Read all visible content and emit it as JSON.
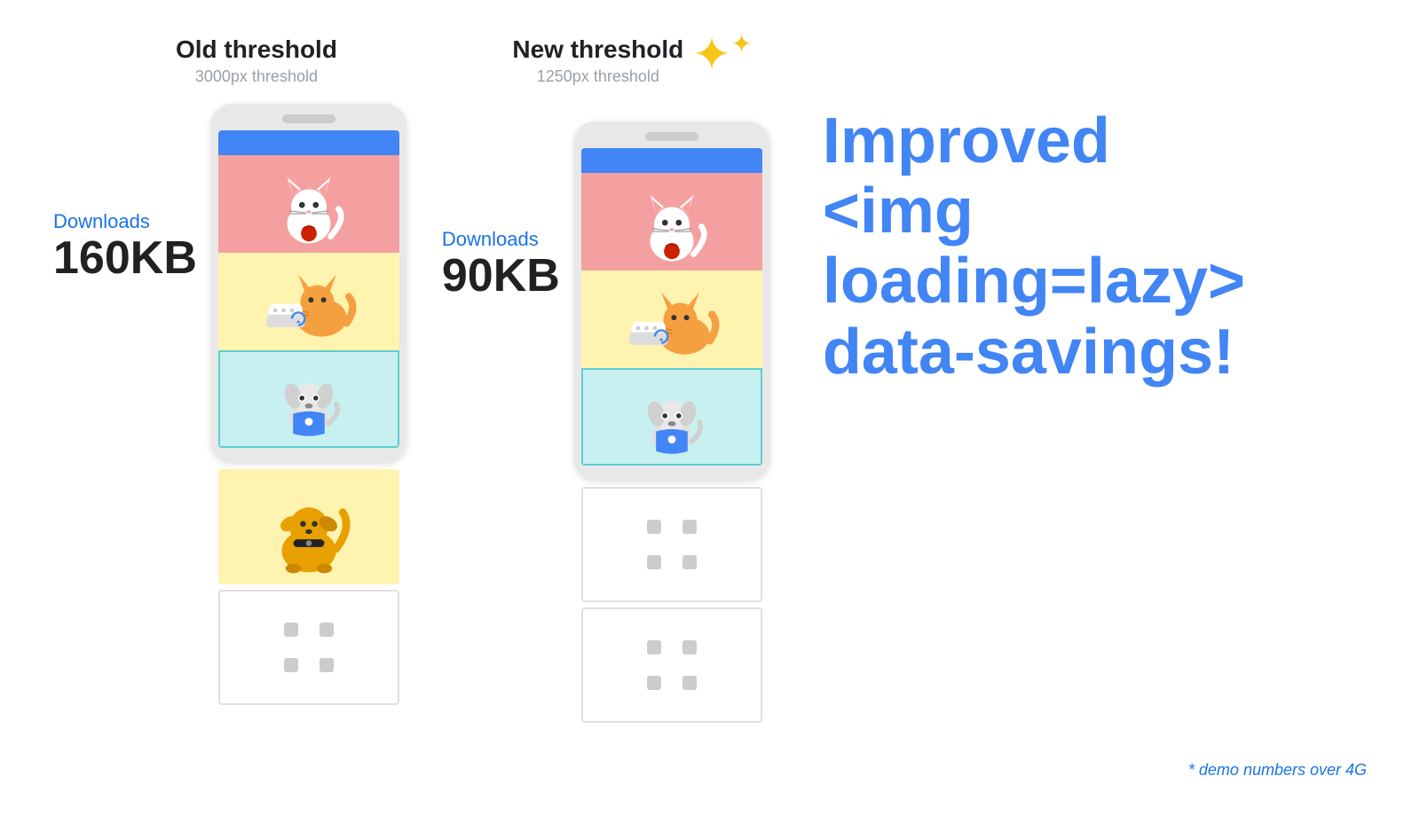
{
  "left": {
    "threshold_title": "Old threshold",
    "threshold_subtitle": "3000px threshold",
    "download_label": "Downloads",
    "download_size": "160KB"
  },
  "right": {
    "threshold_title": "New threshold",
    "threshold_subtitle": "1250px threshold",
    "download_label": "Downloads",
    "download_size": "90KB"
  },
  "info": {
    "line1": "Improved",
    "line2": "<img loading=lazy>",
    "line3": "data-savings!"
  },
  "demo_note": "* demo numbers over 4G",
  "sparkle_char": "✦"
}
